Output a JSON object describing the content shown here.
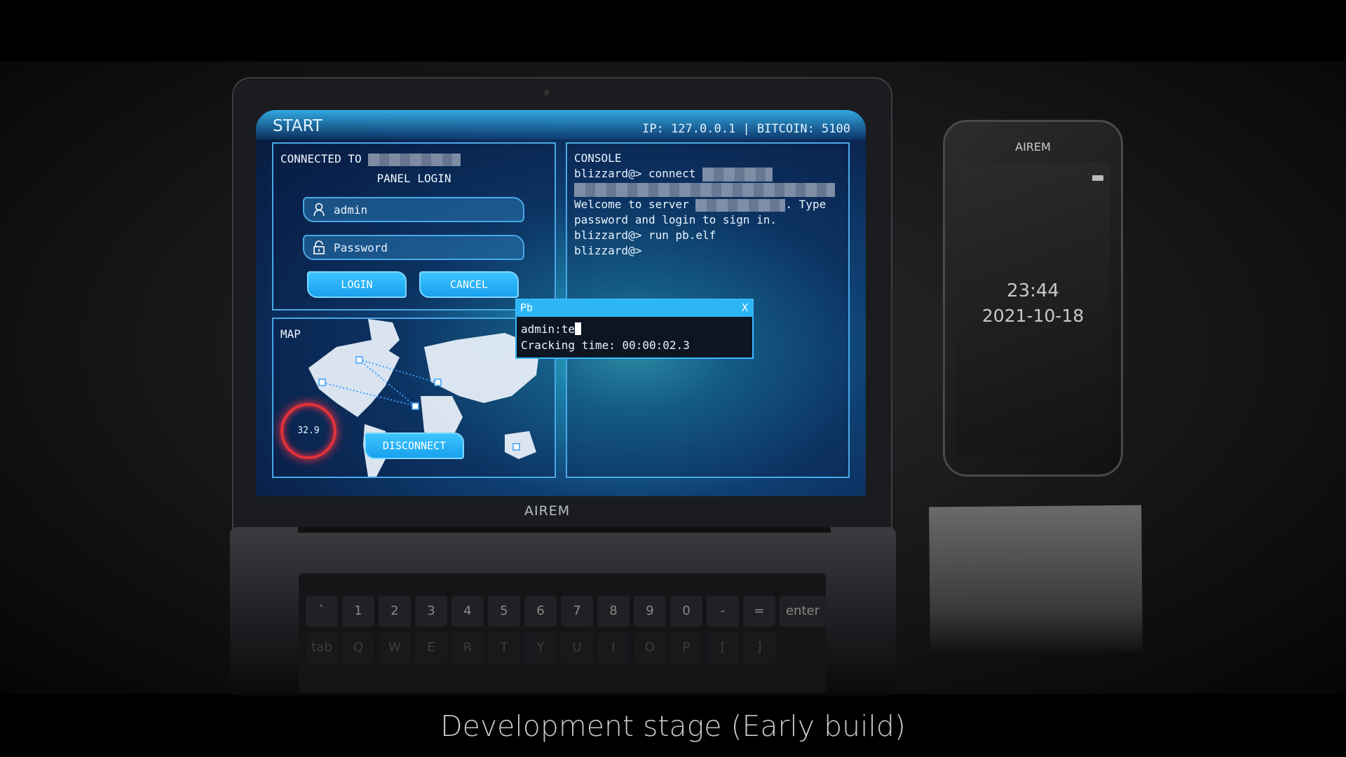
{
  "screen": {
    "title": "START",
    "ip": "IP: 127.0.0.1",
    "bitcoin": "BITCOIN: 5100",
    "separator": "|"
  },
  "login_panel": {
    "connected_to": "CONNECTED TO",
    "heading": "PANEL LOGIN",
    "username_value": "admin",
    "password_placeholder": "Password",
    "login_label": "LOGIN",
    "cancel_label": "CANCEL"
  },
  "console": {
    "heading": "CONSOLE",
    "line1": "blizzard@> connect",
    "line2a": "Welcome to server",
    "line2b": ". Type",
    "line3": "password and login to sign in.",
    "line4": "blizzard@> run pb.elf",
    "line5": "blizzard@>"
  },
  "map": {
    "heading": "MAP",
    "gauge_value": "32.9",
    "disconnect_label": "DISCONNECT"
  },
  "pb_dialog": {
    "title": "Pb",
    "close": "X",
    "input": "admin:te",
    "cracking": "Cracking time: 00:00:02.3"
  },
  "laptop": {
    "brand": "AIREM",
    "keys_row1": [
      "`",
      "1",
      "2",
      "3",
      "4",
      "5",
      "6",
      "7",
      "8",
      "9",
      "0",
      "-",
      "=",
      "enter"
    ],
    "keys_row2": [
      "tab",
      "Q",
      "W",
      "E",
      "R",
      "T",
      "Y",
      "U",
      "I",
      "O",
      "P",
      "[",
      "]"
    ]
  },
  "phone": {
    "brand": "AIREM",
    "time": "23:44",
    "date": "2021-10-18"
  },
  "caption": "Development stage (Early build)",
  "colors": {
    "accent": "#2cb6f6",
    "gauge": "#e3323a"
  }
}
